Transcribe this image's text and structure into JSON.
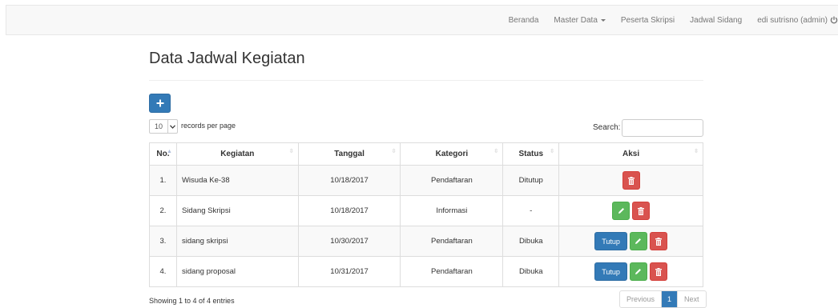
{
  "navbar": {
    "items": [
      {
        "label": "Beranda"
      },
      {
        "label": "Master Data"
      },
      {
        "label": "Peserta Skripsi"
      },
      {
        "label": "Jadwal Sidang"
      },
      {
        "label": "edi sutrisno (admin)"
      }
    ]
  },
  "page": {
    "title": "Data Jadwal Kegiatan"
  },
  "controls": {
    "add_icon": "plus-icon",
    "length_value": "10",
    "length_label": "records per page",
    "search_label": "Search:",
    "search_value": ""
  },
  "table": {
    "columns": [
      "No.",
      "Kegiatan",
      "Tanggal",
      "Kategori",
      "Status",
      "Aksi"
    ],
    "rows": [
      {
        "no": "1.",
        "kegiatan": "Wisuda Ke-38",
        "tanggal": "10/18/2017",
        "kategori": "Pendaftaran",
        "status": "Ditutup",
        "actions": [
          "delete"
        ]
      },
      {
        "no": "2.",
        "kegiatan": "Sidang Skripsi",
        "tanggal": "10/18/2017",
        "kategori": "Informasi",
        "status": "-",
        "actions": [
          "edit",
          "delete"
        ]
      },
      {
        "no": "3.",
        "kegiatan": "sidang skripsi",
        "tanggal": "10/30/2017",
        "kategori": "Pendaftaran",
        "status": "Dibuka",
        "actions": [
          "close",
          "edit",
          "delete"
        ]
      },
      {
        "no": "4.",
        "kegiatan": "sidang proposal",
        "tanggal": "10/31/2017",
        "kategori": "Pendaftaran",
        "status": "Dibuka",
        "actions": [
          "close",
          "edit",
          "delete"
        ]
      }
    ],
    "close_label": "Tutup"
  },
  "footer": {
    "info": "Showing 1 to 4 of 4 entries",
    "prev_label": "Previous",
    "page": "1",
    "next_label": "Next"
  },
  "colors": {
    "primary": "#337ab7",
    "success": "#5cb85c",
    "danger": "#d9534f"
  }
}
